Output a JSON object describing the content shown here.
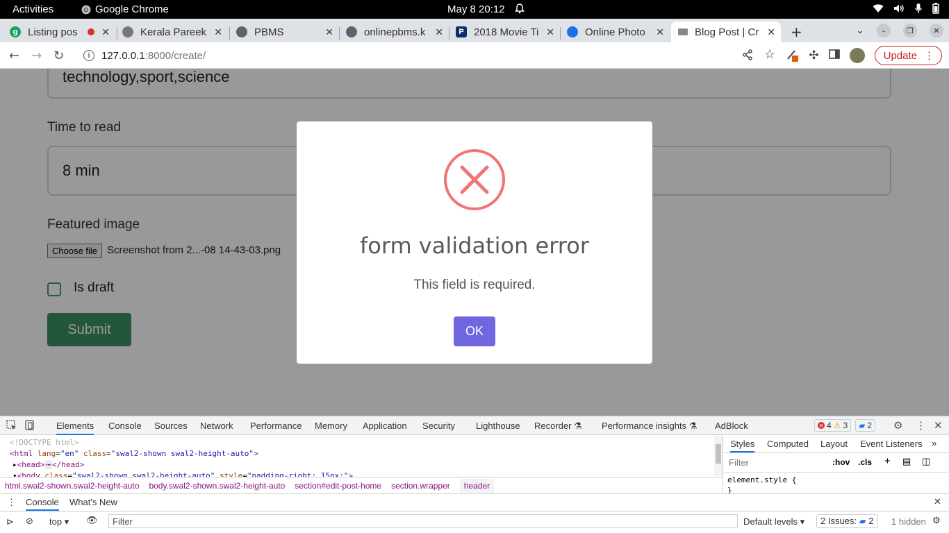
{
  "os_bar": {
    "activities": "Activities",
    "app_name": "Google Chrome",
    "clock": "May 8  20:12"
  },
  "tabs": [
    {
      "title": "Listing pos",
      "favicon_color": "#1aa260"
    },
    {
      "title": "Kerala Pareek",
      "favicon_color": "#777777"
    },
    {
      "title": "PBMS",
      "favicon_color": "#5f6368"
    },
    {
      "title": "onlinepbms.k",
      "favicon_color": "#5f6368"
    },
    {
      "title": "2018 Movie Ti",
      "favicon_color": "#0b2f6b"
    },
    {
      "title": "Online Photo",
      "favicon_color": "#1a73e8"
    },
    {
      "title": "Blog Post | Cr",
      "favicon_color": "#888888"
    }
  ],
  "omnibox": {
    "host": "127.0.0.1",
    "path": ":8000/create/"
  },
  "toolbar": {
    "update_label": "Update"
  },
  "page": {
    "tags_value": "technology,sport,science",
    "time_label": "Time to read",
    "time_value": "8 min",
    "image_label": "Featured image",
    "choose_file": "Choose file",
    "file_name": "Screenshot from 2...-08 14-43-03.png",
    "draft_label": "Is draft",
    "submit_label": "Submit"
  },
  "modal": {
    "title": "form validation error",
    "message": "This field is required.",
    "ok_label": "OK",
    "icon_color": "#f27474",
    "button_color": "#7066e0"
  },
  "devtools": {
    "tabs": [
      "Elements",
      "Console",
      "Sources",
      "Network",
      "Performance",
      "Memory",
      "Application",
      "Security",
      "Lighthouse",
      "Recorder ⚗",
      "Performance insights ⚗",
      "AdBlock"
    ],
    "errors": "4",
    "warnings": "3",
    "messages": "2",
    "dom_doctype": "<!DOCTYPE html>",
    "breadcrumbs": [
      "html.swal2-shown.swal2-height-auto",
      "body.swal2-shown.swal2-height-auto",
      "section#edit-post-home",
      "section.wrapper",
      "header"
    ],
    "styles_tabs": [
      "Styles",
      "Computed",
      "Layout",
      "Event Listeners"
    ],
    "styles_filter": "Filter",
    "hov": ":hov",
    "cls": ".cls",
    "element_style": "element.style {",
    "close_brace": "}",
    "drawer_tabs": [
      "Console",
      "What's New"
    ],
    "context": "top",
    "console_filter": "Filter",
    "default_levels": "Default levels",
    "issues": "2 Issues:",
    "issues_count": "2",
    "hidden": "1 hidden"
  }
}
